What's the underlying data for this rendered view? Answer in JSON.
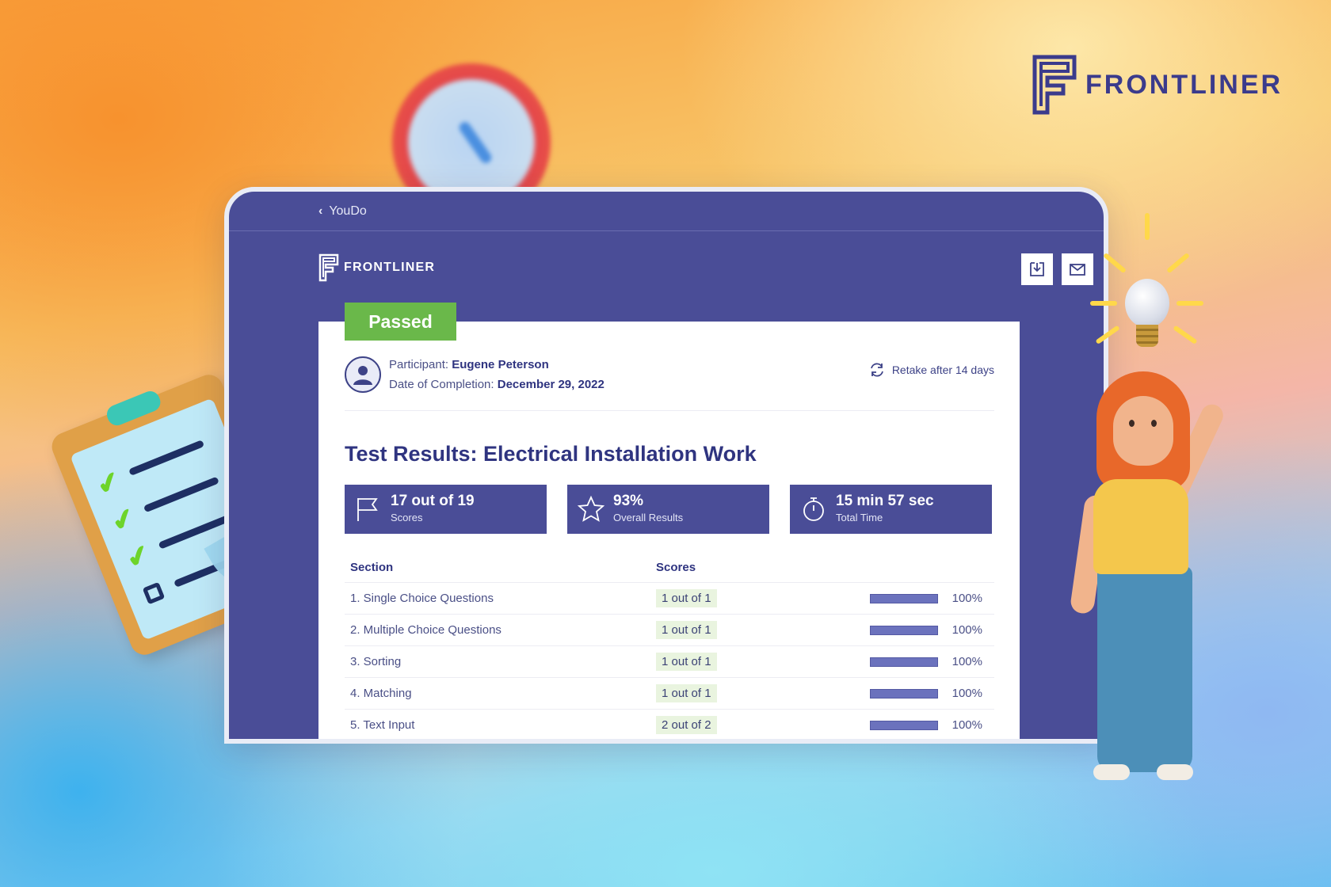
{
  "brand": {
    "name": "FRONTLINER",
    "color": "#3b3b8c"
  },
  "topbar": {
    "back_label": "YouDo"
  },
  "app": {
    "logo_text": "FRONTLINER",
    "download_icon": "download-icon",
    "mail_icon": "mail-icon"
  },
  "result": {
    "status": "Passed",
    "status_color": "#6ab84a",
    "participant_label": "Participant:",
    "participant_name": "Eugene Peterson",
    "date_label": "Date of Completion:",
    "date_value": "December 29, 2022",
    "retake_text": "Retake after 14 days",
    "title": "Test Results: Electrical Installation Work"
  },
  "stats": [
    {
      "icon": "flag-icon",
      "value": "17 out of 19",
      "label": "Scores"
    },
    {
      "icon": "star-icon",
      "value": "93%",
      "label": "Overall Results"
    },
    {
      "icon": "stopwatch-icon",
      "value": "15 min 57 sec",
      "label": "Total Time"
    }
  ],
  "table": {
    "headers": {
      "section": "Section",
      "scores": "Scores"
    },
    "rows": [
      {
        "section": "1. Single Choice Questions",
        "score": "1 out of 1",
        "percent": "100%",
        "progress": 1.0
      },
      {
        "section": "2. Multiple Choice Questions",
        "score": "1 out of 1",
        "percent": "100%",
        "progress": 1.0
      },
      {
        "section": "3. Sorting",
        "score": "1 out of 1",
        "percent": "100%",
        "progress": 1.0
      },
      {
        "section": "4. Matching",
        "score": "1 out of 1",
        "percent": "100%",
        "progress": 1.0
      },
      {
        "section": "5. Text Input",
        "score": "2 out of 2",
        "percent": "100%",
        "progress": 1.0
      }
    ]
  },
  "colors": {
    "accent": "#4a4d97",
    "title": "#2f3480",
    "score_chip": "#e9f4df"
  }
}
